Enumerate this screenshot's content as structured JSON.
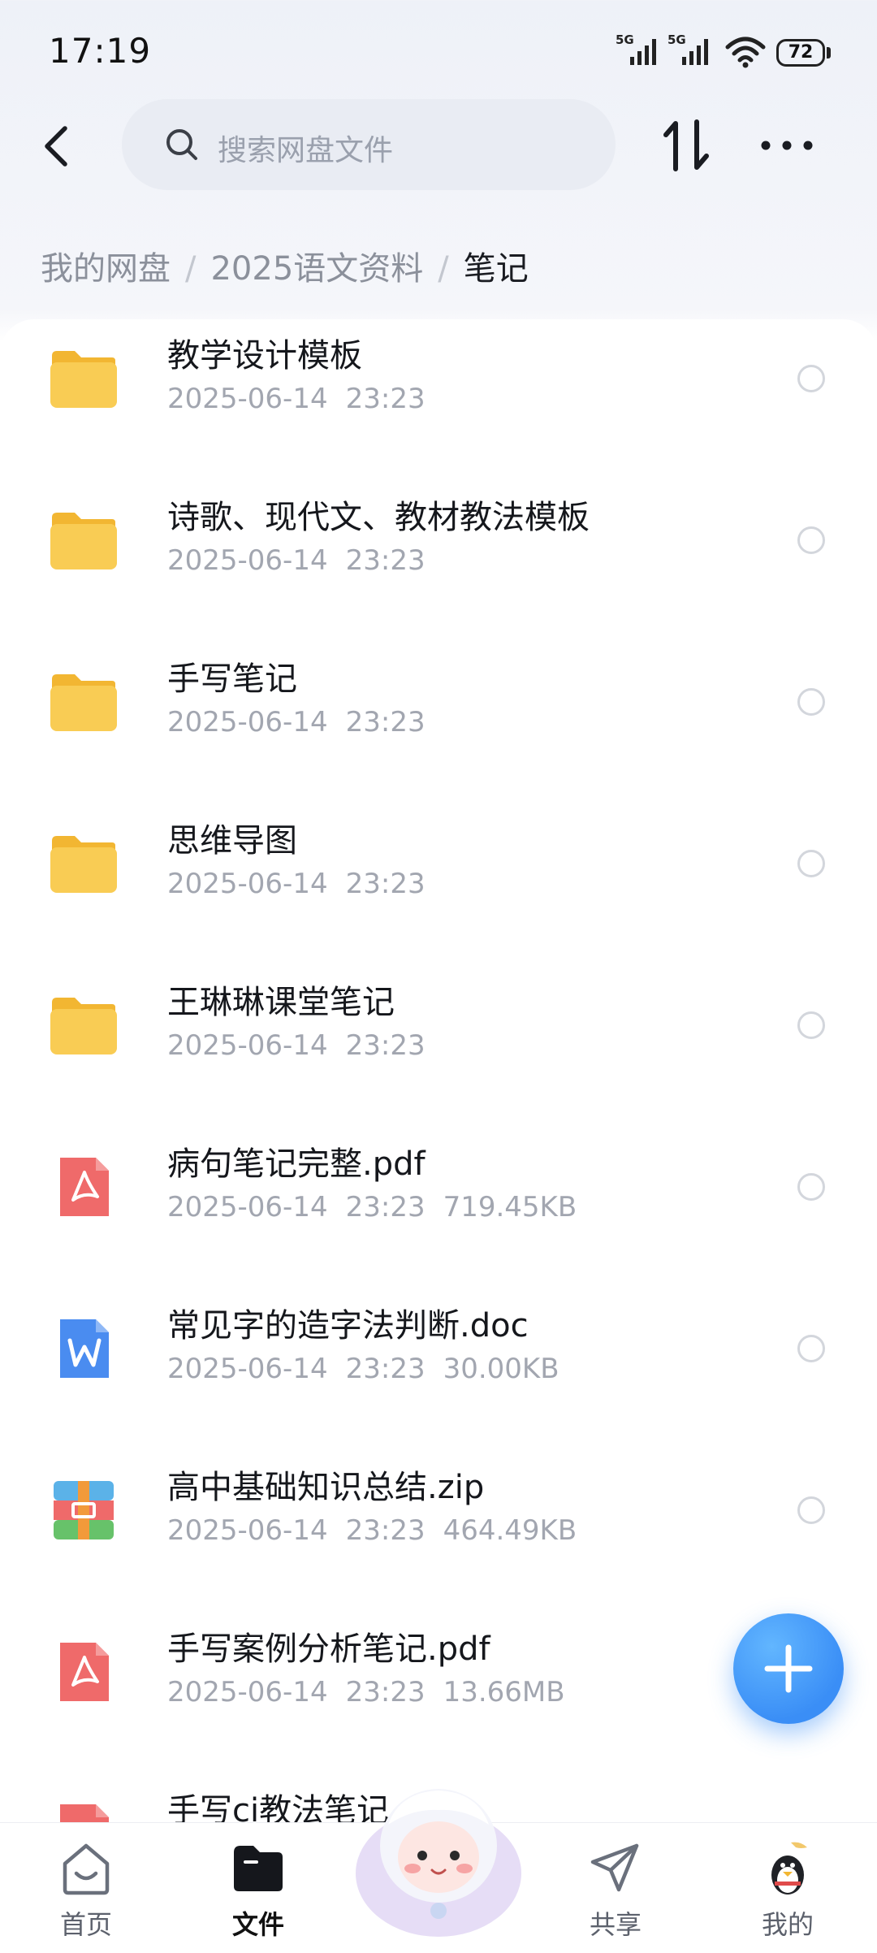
{
  "status_bar": {
    "time": "17:19",
    "network_1": "5G",
    "network_2": "5G",
    "battery": "72"
  },
  "search": {
    "placeholder": "搜索网盘文件"
  },
  "breadcrumb": {
    "root": "我的网盘",
    "parent": "2025语文资料",
    "current": "笔记"
  },
  "files": [
    {
      "name": "教学设计模板",
      "date": "2025-06-14",
      "time": "23:23",
      "size": "",
      "type": "folder"
    },
    {
      "name": "诗歌、现代文、教材教法模板",
      "date": "2025-06-14",
      "time": "23:23",
      "size": "",
      "type": "folder"
    },
    {
      "name": "手写笔记",
      "date": "2025-06-14",
      "time": "23:23",
      "size": "",
      "type": "folder"
    },
    {
      "name": "思维导图",
      "date": "2025-06-14",
      "time": "23:23",
      "size": "",
      "type": "folder"
    },
    {
      "name": "王琳琳课堂笔记",
      "date": "2025-06-14",
      "time": "23:23",
      "size": "",
      "type": "folder"
    },
    {
      "name": "病句笔记完整.pdf",
      "date": "2025-06-14",
      "time": "23:23",
      "size": "719.45KB",
      "type": "pdf"
    },
    {
      "name": "常见字的造字法判断.doc",
      "date": "2025-06-14",
      "time": "23:23",
      "size": "30.00KB",
      "type": "doc"
    },
    {
      "name": "高中基础知识总结.zip",
      "date": "2025-06-14",
      "time": "23:23",
      "size": "464.49KB",
      "type": "zip"
    },
    {
      "name": "手写案例分析笔记.pdf",
      "date": "2025-06-14",
      "time": "23:23",
      "size": "13.66MB",
      "type": "pdf"
    },
    {
      "name": "手写ci教法笔记",
      "date": "",
      "time": "",
      "size": "",
      "type": "pdf"
    }
  ],
  "tabs": {
    "home": "首页",
    "files": "文件",
    "share": "共享",
    "mine": "我的"
  },
  "colors": {
    "accent": "#3a8ef6",
    "folder": "#f7c948",
    "pdf": "#ef6a6a",
    "doc": "#4a8cf0"
  }
}
